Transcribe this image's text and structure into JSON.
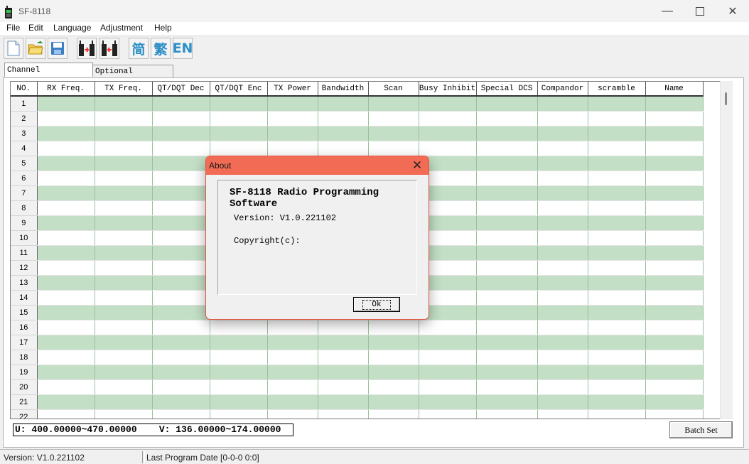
{
  "window": {
    "title": "SF-8118",
    "icon": "radio-app-icon"
  },
  "menu": [
    "File",
    "Edit",
    "Language",
    "Adjustment",
    "Help"
  ],
  "toolbar": {
    "buttons": [
      "new-file-icon",
      "open-folder-icon",
      "save-disk-icon",
      "read-radio-icon",
      "write-radio-icon"
    ],
    "lang_simplified": "简",
    "lang_traditional": "繁",
    "lang_english": "EN"
  },
  "tabs": [
    "Channel information",
    "Optional Features"
  ],
  "table": {
    "columns": [
      "NO.",
      "RX Freq.",
      "TX Freq.",
      "QT/DQT Dec",
      "QT/DQT Enc",
      "TX Power",
      "Bandwidth",
      "Scan",
      "Busy Inhibit",
      "Special DCS",
      "Compandor",
      "scramble",
      "Name"
    ],
    "rows": [
      "1",
      "2",
      "3",
      "4",
      "5",
      "6",
      "7",
      "8",
      "9",
      "10",
      "11",
      "12",
      "13",
      "14",
      "15",
      "16",
      "17",
      "18",
      "19",
      "20",
      "21",
      "22"
    ]
  },
  "freq_range": "U: 400.00000~470.00000    V: 136.00000~174.00000",
  "batch_button": "Batch Set",
  "status": {
    "version": "Version: V1.0.221102",
    "last_program": "Last Program Date [0-0-0  0:0]"
  },
  "about_dialog": {
    "title": "About",
    "heading": "SF-8118 Radio Programming Software",
    "version": "Version: V1.0.221102",
    "copyright": "Copyright(c):",
    "ok_label": "Ok"
  },
  "colors": {
    "dialog_title": "#f26b54",
    "row_alt": "#c3dfc6",
    "lang_icon": "#2d8fc6"
  }
}
